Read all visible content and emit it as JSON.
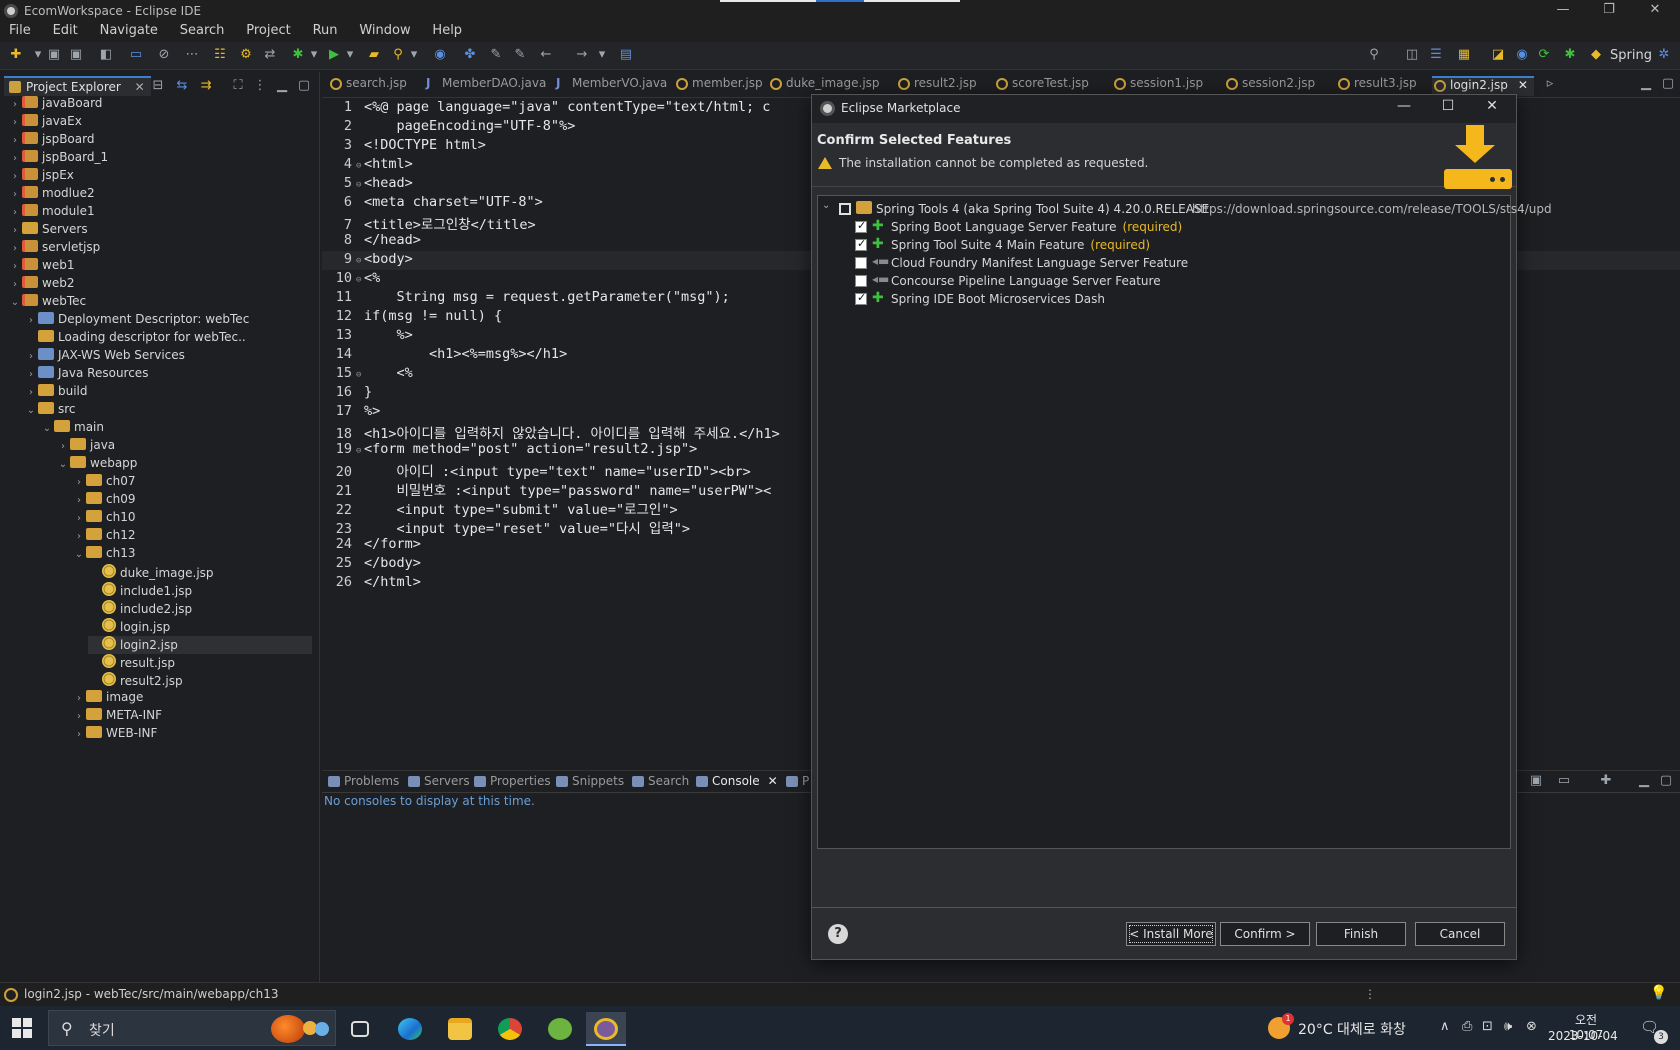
{
  "window": {
    "title": "EcomWorkspace - Eclipse IDE",
    "min": "—",
    "max": "❐",
    "close": "✕"
  },
  "menu": [
    "File",
    "Edit",
    "Navigate",
    "Search",
    "Project",
    "Run",
    "Window",
    "Help"
  ],
  "toolbar": {
    "perspective": "Spring"
  },
  "explorer": {
    "tab_label": "Project Explorer",
    "close": "✕",
    "tree": [
      {
        "label": "javaBoard",
        "depth": 0,
        "twisty": "›",
        "icon": "proj"
      },
      {
        "label": "javaEx",
        "depth": 0,
        "twisty": "›",
        "icon": "proj"
      },
      {
        "label": "jspBoard",
        "depth": 0,
        "twisty": "›",
        "icon": "proj"
      },
      {
        "label": "jspBoard_1",
        "depth": 0,
        "twisty": "›",
        "icon": "proj"
      },
      {
        "label": "jspEx",
        "depth": 0,
        "twisty": "›",
        "icon": "proj"
      },
      {
        "label": "modlue2",
        "depth": 0,
        "twisty": "›",
        "icon": "proj"
      },
      {
        "label": "module1",
        "depth": 0,
        "twisty": "›",
        "icon": "proj"
      },
      {
        "label": "Servers",
        "depth": 0,
        "twisty": "›",
        "icon": "folder"
      },
      {
        "label": "servletjsp",
        "depth": 0,
        "twisty": "›",
        "icon": "proj"
      },
      {
        "label": "web1",
        "depth": 0,
        "twisty": "›",
        "icon": "proj"
      },
      {
        "label": "web2",
        "depth": 0,
        "twisty": "›",
        "icon": "proj"
      },
      {
        "label": "webTec",
        "depth": 0,
        "twisty": "⌄",
        "icon": "proj"
      },
      {
        "label": "Deployment Descriptor: webTec",
        "depth": 1,
        "twisty": "›",
        "icon": "other"
      },
      {
        "label": "Loading descriptor for webTec..",
        "depth": 1,
        "twisty": "",
        "icon": "folder"
      },
      {
        "label": "JAX-WS Web Services",
        "depth": 1,
        "twisty": "›",
        "icon": "other"
      },
      {
        "label": "Java Resources",
        "depth": 1,
        "twisty": "›",
        "icon": "other"
      },
      {
        "label": "build",
        "depth": 1,
        "twisty": "›",
        "icon": "folder"
      },
      {
        "label": "src",
        "depth": 1,
        "twisty": "⌄",
        "icon": "folder"
      },
      {
        "label": "main",
        "depth": 2,
        "twisty": "⌄",
        "icon": "folder"
      },
      {
        "label": "java",
        "depth": 3,
        "twisty": "›",
        "icon": "folder"
      },
      {
        "label": "webapp",
        "depth": 3,
        "twisty": "⌄",
        "icon": "folder"
      },
      {
        "label": "ch07",
        "depth": 4,
        "twisty": "›",
        "icon": "folder"
      },
      {
        "label": "ch09",
        "depth": 4,
        "twisty": "›",
        "icon": "folder"
      },
      {
        "label": "ch10",
        "depth": 4,
        "twisty": "›",
        "icon": "folder"
      },
      {
        "label": "ch12",
        "depth": 4,
        "twisty": "›",
        "icon": "folder"
      },
      {
        "label": "ch13",
        "depth": 4,
        "twisty": "⌄",
        "icon": "folder"
      },
      {
        "label": "duke_image.jsp",
        "depth": 5,
        "twisty": "",
        "icon": "jsp"
      },
      {
        "label": "include1.jsp",
        "depth": 5,
        "twisty": "",
        "icon": "jsp"
      },
      {
        "label": "include2.jsp",
        "depth": 5,
        "twisty": "",
        "icon": "jsp"
      },
      {
        "label": "login.jsp",
        "depth": 5,
        "twisty": "",
        "icon": "jsp"
      },
      {
        "label": "login2.jsp",
        "depth": 5,
        "twisty": "",
        "icon": "jsp",
        "selected": true
      },
      {
        "label": "result.jsp",
        "depth": 5,
        "twisty": "",
        "icon": "jsp"
      },
      {
        "label": "result2.jsp",
        "depth": 5,
        "twisty": "",
        "icon": "jsp"
      },
      {
        "label": "image",
        "depth": 4,
        "twisty": "›",
        "icon": "folder"
      },
      {
        "label": "META-INF",
        "depth": 4,
        "twisty": "›",
        "icon": "folder"
      },
      {
        "label": "WEB-INF",
        "depth": 4,
        "twisty": "›",
        "icon": "folder"
      }
    ]
  },
  "editor_tabs": [
    {
      "label": "search.jsp",
      "icon": "jsp"
    },
    {
      "label": "MemberDAO.java",
      "icon": "java"
    },
    {
      "label": "MemberVO.java",
      "icon": "java"
    },
    {
      "label": "member.jsp",
      "icon": "jsp"
    },
    {
      "label": "duke_image.jsp",
      "icon": "jsp"
    },
    {
      "label": "result2.jsp",
      "icon": "jsp"
    },
    {
      "label": "scoreTest.jsp",
      "icon": "jsp"
    },
    {
      "label": "session1.jsp",
      "icon": "jsp"
    },
    {
      "label": "session2.jsp",
      "icon": "jsp"
    },
    {
      "label": "result3.jsp",
      "icon": "jsp"
    },
    {
      "label": "login2.jsp",
      "icon": "jsp",
      "active": true,
      "close": "✕"
    }
  ],
  "code_lines": [
    {
      "n": "1",
      "fold": "",
      "text": "<%@ page language=\"java\" contentType=\"text/html; c"
    },
    {
      "n": "2",
      "fold": "",
      "text": "    pageEncoding=\"UTF-8\"%>"
    },
    {
      "n": "3",
      "fold": "",
      "text": "<!DOCTYPE html>"
    },
    {
      "n": "4",
      "fold": "⊖",
      "text": "<html>"
    },
    {
      "n": "5",
      "fold": "⊖",
      "text": "<head>"
    },
    {
      "n": "6",
      "fold": "",
      "text": "<meta charset=\"UTF-8\">"
    },
    {
      "n": "7",
      "fold": "",
      "text": "<title>로그인창</title>"
    },
    {
      "n": "8",
      "fold": "",
      "text": "</head>"
    },
    {
      "n": "9",
      "fold": "⊖",
      "text": "<body>",
      "current": true
    },
    {
      "n": "10",
      "fold": "⊖",
      "text": "<%"
    },
    {
      "n": "11",
      "fold": "",
      "text": "    String msg = request.getParameter(\"msg\");"
    },
    {
      "n": "12",
      "fold": "",
      "text": "if(msg != null) {"
    },
    {
      "n": "13",
      "fold": "",
      "text": "    %>"
    },
    {
      "n": "14",
      "fold": "",
      "text": "        <h1><%=msg%></h1>"
    },
    {
      "n": "15",
      "fold": "⊖",
      "text": "    <%"
    },
    {
      "n": "16",
      "fold": "",
      "text": "}"
    },
    {
      "n": "17",
      "fold": "",
      "text": "%>"
    },
    {
      "n": "18",
      "fold": "",
      "text": "<h1>아이디를 입력하지 않았습니다. 아이디를 입력해 주세요.</h1>"
    },
    {
      "n": "19",
      "fold": "⊖",
      "text": "<form method=\"post\" action=\"result2.jsp\">"
    },
    {
      "n": "20",
      "fold": "",
      "text": "    아이디 :<input type=\"text\" name=\"userID\"><br>"
    },
    {
      "n": "21",
      "fold": "",
      "text": "    비밀번호 :<input type=\"password\" name=\"userPW\"><"
    },
    {
      "n": "22",
      "fold": "",
      "text": "    <input type=\"submit\" value=\"로그인\">"
    },
    {
      "n": "23",
      "fold": "",
      "text": "    <input type=\"reset\" value=\"다시 입력\">"
    },
    {
      "n": "24",
      "fold": "",
      "text": "</form>"
    },
    {
      "n": "25",
      "fold": "",
      "text": "</body>"
    },
    {
      "n": "26",
      "fold": "",
      "text": "</html>"
    }
  ],
  "console": {
    "tabs": [
      "Problems",
      "Servers",
      "Properties",
      "Snippets",
      "Search",
      "Console",
      "P"
    ],
    "active": "Console",
    "close": "✕",
    "message": "No consoles to display at this time."
  },
  "status": {
    "path": "login2.jsp - webTec/src/main/webapp/ch13"
  },
  "taskbar": {
    "search_placeholder": "찾기",
    "weather": "20°C 대체로 화창",
    "weather_badge": "1",
    "time": "오전 10:07",
    "date": "2023-10-04",
    "notification_count": "3"
  },
  "dialog": {
    "title": "Eclipse Marketplace",
    "heading": "Confirm Selected Features",
    "warning": "The installation cannot be completed as requested.",
    "root": {
      "label": "Spring Tools 4 (aka Spring Tool Suite 4) 4.20.0.RELEASE",
      "url": "https://download.springsource.com/release/TOOLS/sts4/upd"
    },
    "features": [
      {
        "label": "Spring Boot Language Server Feature",
        "required": "(required)",
        "checked": true,
        "icon": "plus"
      },
      {
        "label": "Spring Tool Suite 4 Main Feature",
        "required": "(required)",
        "checked": true,
        "icon": "plus"
      },
      {
        "label": "Cloud Foundry Manifest Language Server Feature",
        "required": "",
        "checked": false,
        "icon": "plug"
      },
      {
        "label": "Concourse Pipeline Language Server Feature",
        "required": "",
        "checked": false,
        "icon": "plug"
      },
      {
        "label": "Spring IDE Boot Microservices Dash",
        "required": "",
        "checked": true,
        "icon": "plus"
      }
    ],
    "buttons": {
      "install_more": "< Install More",
      "confirm": "Confirm >",
      "finish": "Finish",
      "cancel": "Cancel"
    },
    "help": "?"
  }
}
